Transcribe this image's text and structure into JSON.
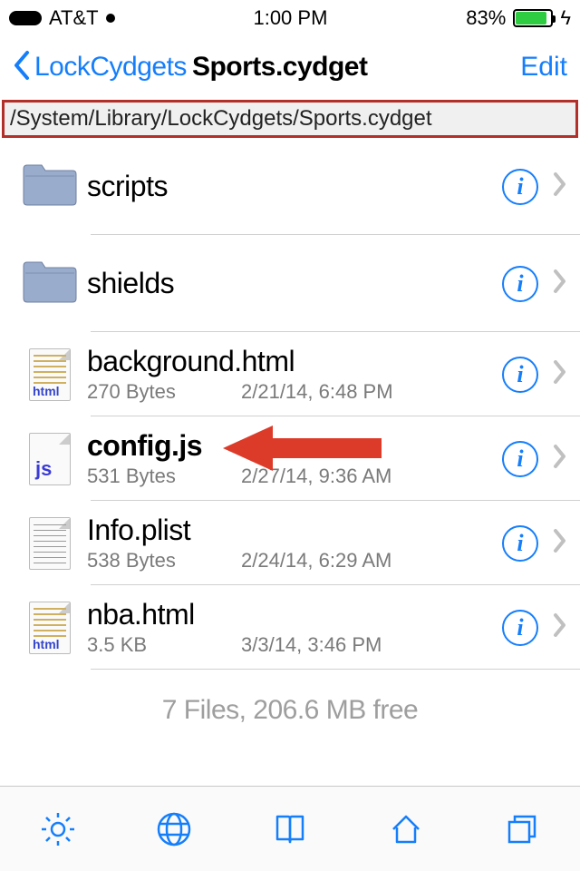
{
  "status_bar": {
    "carrier": "AT&T",
    "time": "1:00 PM",
    "battery_pct": "83%"
  },
  "nav": {
    "back_label": "LockCydgets",
    "title": "Sports.cydget",
    "edit_label": "Edit"
  },
  "path": "/System/Library/LockCydgets/Sports.cydget",
  "rows": [
    {
      "kind": "folder",
      "name": "scripts"
    },
    {
      "kind": "folder",
      "name": "shields"
    },
    {
      "kind": "file",
      "name": "background.html",
      "size": "270 Bytes",
      "date": "2/21/14, 6:48 PM",
      "ext": "html"
    },
    {
      "kind": "file",
      "name": "config.js",
      "size": "531 Bytes",
      "date": "2/27/14, 9:36 AM",
      "ext": "js"
    },
    {
      "kind": "file",
      "name": "Info.plist",
      "size": "538 Bytes",
      "date": "2/24/14, 6:29 AM",
      "ext": "txt"
    },
    {
      "kind": "file",
      "name": "nba.html",
      "size": "3.5 KB",
      "date": "3/3/14, 3:46 PM",
      "ext": "html"
    }
  ],
  "summary": "7 Files, 206.6 MB free",
  "colors": {
    "accent": "#157efb",
    "annotation": "#dd3b2a"
  }
}
